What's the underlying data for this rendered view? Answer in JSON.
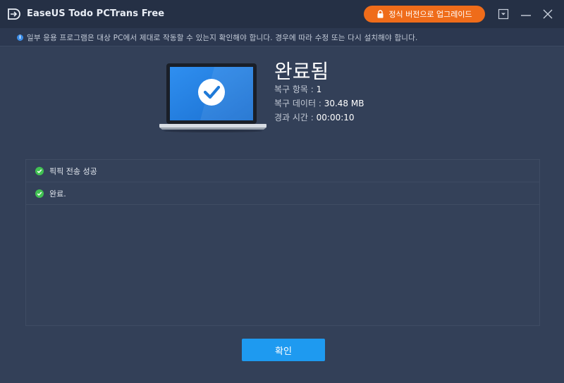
{
  "app": {
    "title": "EaseUS Todo PCTrans Free"
  },
  "titlebar": {
    "upgrade_label": "정식 버전으로 업그레이드"
  },
  "notice": {
    "text": "일부 응용 프로그램은 대상 PC에서 제대로 작동할 수 있는지 확인해야 합니다. 경우에 따라 수정 또는 다시 설치해야 합니다."
  },
  "result": {
    "title": "완료됨",
    "items_label": "복구 항목 : ",
    "items_value": "1",
    "data_label": "복구 데이터 : ",
    "data_value": "30.48 MB",
    "time_label": "경과 시간 : ",
    "time_value": "00:00:10"
  },
  "log": [
    {
      "text": "픽픽 전송 성공",
      "status": "success"
    },
    {
      "text": "완료.",
      "status": "success"
    }
  ],
  "footer": {
    "confirm_label": "확인"
  },
  "colors": {
    "accent": "#1e9af0",
    "upgrade": "#ef6c1a",
    "success": "#41c152",
    "background": "#334058"
  },
  "icons": [
    "easeus-logo-icon",
    "lock-icon",
    "dropdown-icon",
    "minimize-icon",
    "close-icon",
    "info-icon",
    "laptop-check-icon",
    "success-check-icon"
  ]
}
